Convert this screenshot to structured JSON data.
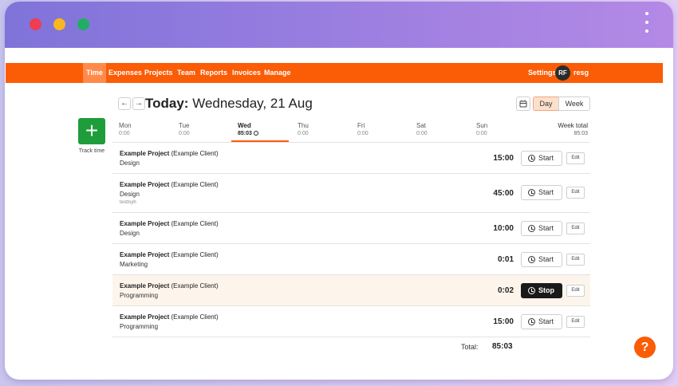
{
  "nav": {
    "items": [
      {
        "label": "Time",
        "active": true
      },
      {
        "label": "Expenses"
      },
      {
        "label": "Projects"
      },
      {
        "label": "Team"
      },
      {
        "label": "Reports"
      },
      {
        "label": "Invoices"
      },
      {
        "label": "Manage"
      }
    ],
    "settings": "Settings",
    "avatar_initials": "RF",
    "user": "resg"
  },
  "date": {
    "prefix": "Today:",
    "value": "Wednesday, 21 Aug"
  },
  "view": {
    "day": "Day",
    "week": "Week",
    "selected": "Day"
  },
  "track_label": "Track time",
  "days": [
    {
      "name": "Mon",
      "total": "0:00"
    },
    {
      "name": "Tue",
      "total": "0:00"
    },
    {
      "name": "Wed",
      "total": "85:03",
      "active": true
    },
    {
      "name": "Thu",
      "total": "0:00"
    },
    {
      "name": "Fri",
      "total": "0:00"
    },
    {
      "name": "Sat",
      "total": "0:00"
    },
    {
      "name": "Sun",
      "total": "0:00"
    }
  ],
  "week_total": {
    "label": "Week total",
    "value": "85:03"
  },
  "entries": [
    {
      "project": "Example Project",
      "client": "(Example Client)",
      "task": "Design",
      "note": "",
      "duration": "15:00",
      "action": "Start",
      "edit": "Edit"
    },
    {
      "project": "Example Project",
      "client": "(Example Client)",
      "task": "Design",
      "note": "testtsyh",
      "duration": "45:00",
      "action": "Start",
      "edit": "Edit"
    },
    {
      "project": "Example Project",
      "client": "(Example Client)",
      "task": "Design",
      "note": "",
      "duration": "10:00",
      "action": "Start",
      "edit": "Edit"
    },
    {
      "project": "Example Project",
      "client": "(Example Client)",
      "task": "Marketing",
      "note": "",
      "duration": "0:01",
      "action": "Start",
      "edit": "Edit"
    },
    {
      "project": "Example Project",
      "client": "(Example Client)",
      "task": "Programming",
      "note": "",
      "duration": "0:02",
      "action": "Stop",
      "edit": "Edit",
      "running": true
    },
    {
      "project": "Example Project",
      "client": "(Example Client)",
      "task": "Programming",
      "note": "",
      "duration": "15:00",
      "action": "Start",
      "edit": "Edit"
    }
  ],
  "total": {
    "label": "Total:",
    "value": "85:03"
  },
  "colors": {
    "brand": "#fb5c06",
    "track": "#1f9d3a",
    "stop": "#1a1a1a"
  },
  "icons": {
    "prev": "arrow-left-icon",
    "next": "arrow-right-icon",
    "calendar": "calendar-icon",
    "clock": "clock-icon",
    "help": "question-icon"
  }
}
